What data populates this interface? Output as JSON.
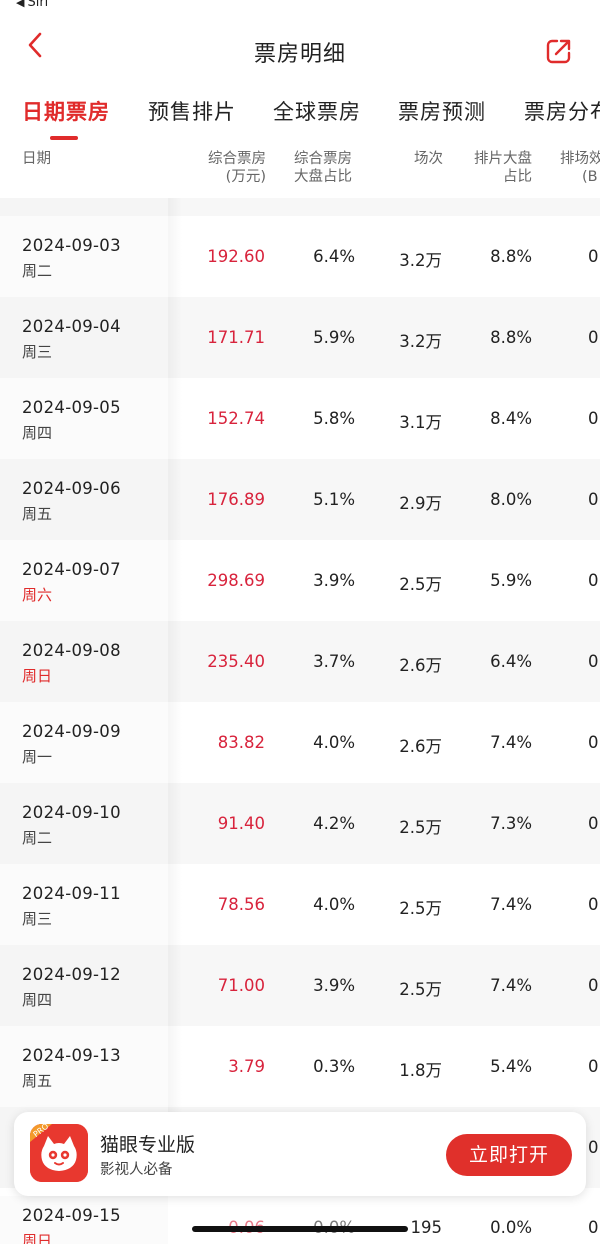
{
  "status_bar": {
    "back_label": "Siri"
  },
  "nav": {
    "title": "票房明细"
  },
  "tabs": [
    "日期票房",
    "预售排片",
    "全球票房",
    "票房预测",
    "票房分布"
  ],
  "table_header": {
    "date": "日期",
    "box_office": [
      "综合票房",
      "(万元)"
    ],
    "box_share": [
      "综合票房",
      "大盘占比"
    ],
    "shows": "场次",
    "schedule_share": [
      "排片大盘",
      "占比"
    ],
    "efficiency": [
      "排场效",
      "(B"
    ]
  },
  "rows": [
    {
      "date": "2024-09-03",
      "weekday": "周二",
      "box_office": "192.60",
      "box_share": "6.4%",
      "shows": "3.2万",
      "schedule_share": "8.8%",
      "efficiency": "0",
      "weekend": false
    },
    {
      "date": "2024-09-04",
      "weekday": "周三",
      "box_office": "171.71",
      "box_share": "5.9%",
      "shows": "3.2万",
      "schedule_share": "8.8%",
      "efficiency": "0",
      "weekend": false
    },
    {
      "date": "2024-09-05",
      "weekday": "周四",
      "box_office": "152.74",
      "box_share": "5.8%",
      "shows": "3.1万",
      "schedule_share": "8.4%",
      "efficiency": "0",
      "weekend": false
    },
    {
      "date": "2024-09-06",
      "weekday": "周五",
      "box_office": "176.89",
      "box_share": "5.1%",
      "shows": "2.9万",
      "schedule_share": "8.0%",
      "efficiency": "0",
      "weekend": false
    },
    {
      "date": "2024-09-07",
      "weekday": "周六",
      "box_office": "298.69",
      "box_share": "3.9%",
      "shows": "2.5万",
      "schedule_share": "5.9%",
      "efficiency": "0",
      "weekend": true
    },
    {
      "date": "2024-09-08",
      "weekday": "周日",
      "box_office": "235.40",
      "box_share": "3.7%",
      "shows": "2.6万",
      "schedule_share": "6.4%",
      "efficiency": "0",
      "weekend": true
    },
    {
      "date": "2024-09-09",
      "weekday": "周一",
      "box_office": "83.82",
      "box_share": "4.0%",
      "shows": "2.6万",
      "schedule_share": "7.4%",
      "efficiency": "0",
      "weekend": false
    },
    {
      "date": "2024-09-10",
      "weekday": "周二",
      "box_office": "91.40",
      "box_share": "4.2%",
      "shows": "2.5万",
      "schedule_share": "7.3%",
      "efficiency": "0",
      "weekend": false
    },
    {
      "date": "2024-09-11",
      "weekday": "周三",
      "box_office": "78.56",
      "box_share": "4.0%",
      "shows": "2.5万",
      "schedule_share": "7.4%",
      "efficiency": "0",
      "weekend": false
    },
    {
      "date": "2024-09-12",
      "weekday": "周四",
      "box_office": "71.00",
      "box_share": "3.9%",
      "shows": "2.5万",
      "schedule_share": "7.4%",
      "efficiency": "0",
      "weekend": false
    },
    {
      "date": "2024-09-13",
      "weekday": "周五",
      "box_office": "3.79",
      "box_share": "0.3%",
      "shows": "1.8万",
      "schedule_share": "5.4%",
      "efficiency": "0",
      "weekend": false
    }
  ],
  "hidden_row_partial": {
    "efficiency": "0"
  },
  "bottom_row": {
    "date": "2024-09-15",
    "weekday": "周日",
    "box_office": "0.06",
    "box_share": "0.0%",
    "shows": "195",
    "schedule_share": "0.0%",
    "efficiency": "0"
  },
  "banner": {
    "app_name": "猫眼专业版",
    "tagline": "影视人必备",
    "open_button": "立即打开",
    "logo_badge": "PRO"
  },
  "colors": {
    "accent": "#e02b2b",
    "box_office": "#d8233c"
  }
}
